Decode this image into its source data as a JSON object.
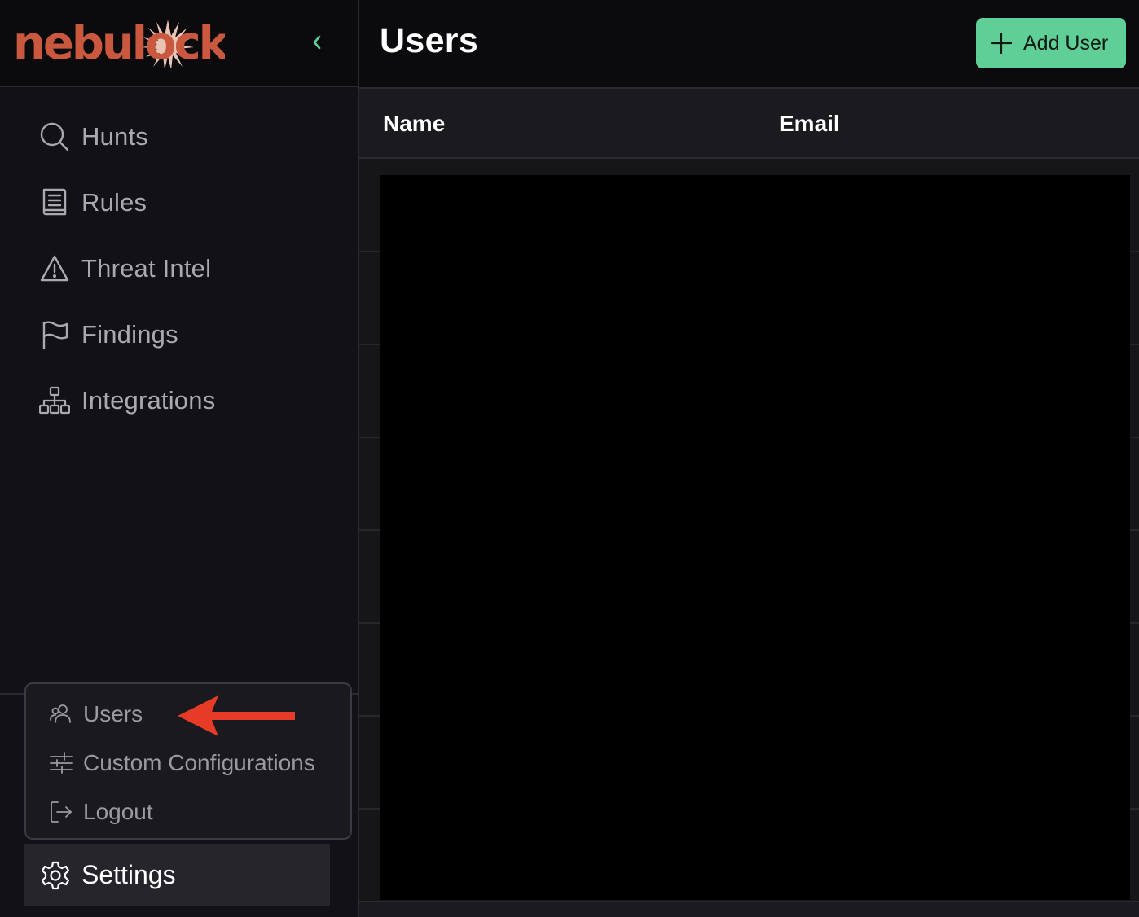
{
  "brand": {
    "logo_text": "nebulock",
    "logo_color": "#c9583f",
    "accent": "#5fcf97"
  },
  "sidebar": {
    "items": [
      {
        "label": "Hunts",
        "icon": "search-icon"
      },
      {
        "label": "Rules",
        "icon": "book-icon"
      },
      {
        "label": "Threat Intel",
        "icon": "warning-icon"
      },
      {
        "label": "Findings",
        "icon": "flag-icon"
      },
      {
        "label": "Integrations",
        "icon": "hierarchy-icon"
      }
    ],
    "settings_menu": {
      "items": [
        {
          "label": "Users",
          "icon": "users-icon"
        },
        {
          "label": "Custom Configurations",
          "icon": "sliders-icon"
        },
        {
          "label": "Logout",
          "icon": "logout-icon"
        }
      ]
    },
    "settings": {
      "label": "Settings",
      "icon": "gear-icon"
    }
  },
  "header": {
    "title": "Users",
    "add_user_label": "Add User"
  },
  "table": {
    "columns": [
      "Name",
      "Email"
    ]
  },
  "annotation": {
    "arrow_color": "#e63b26"
  }
}
